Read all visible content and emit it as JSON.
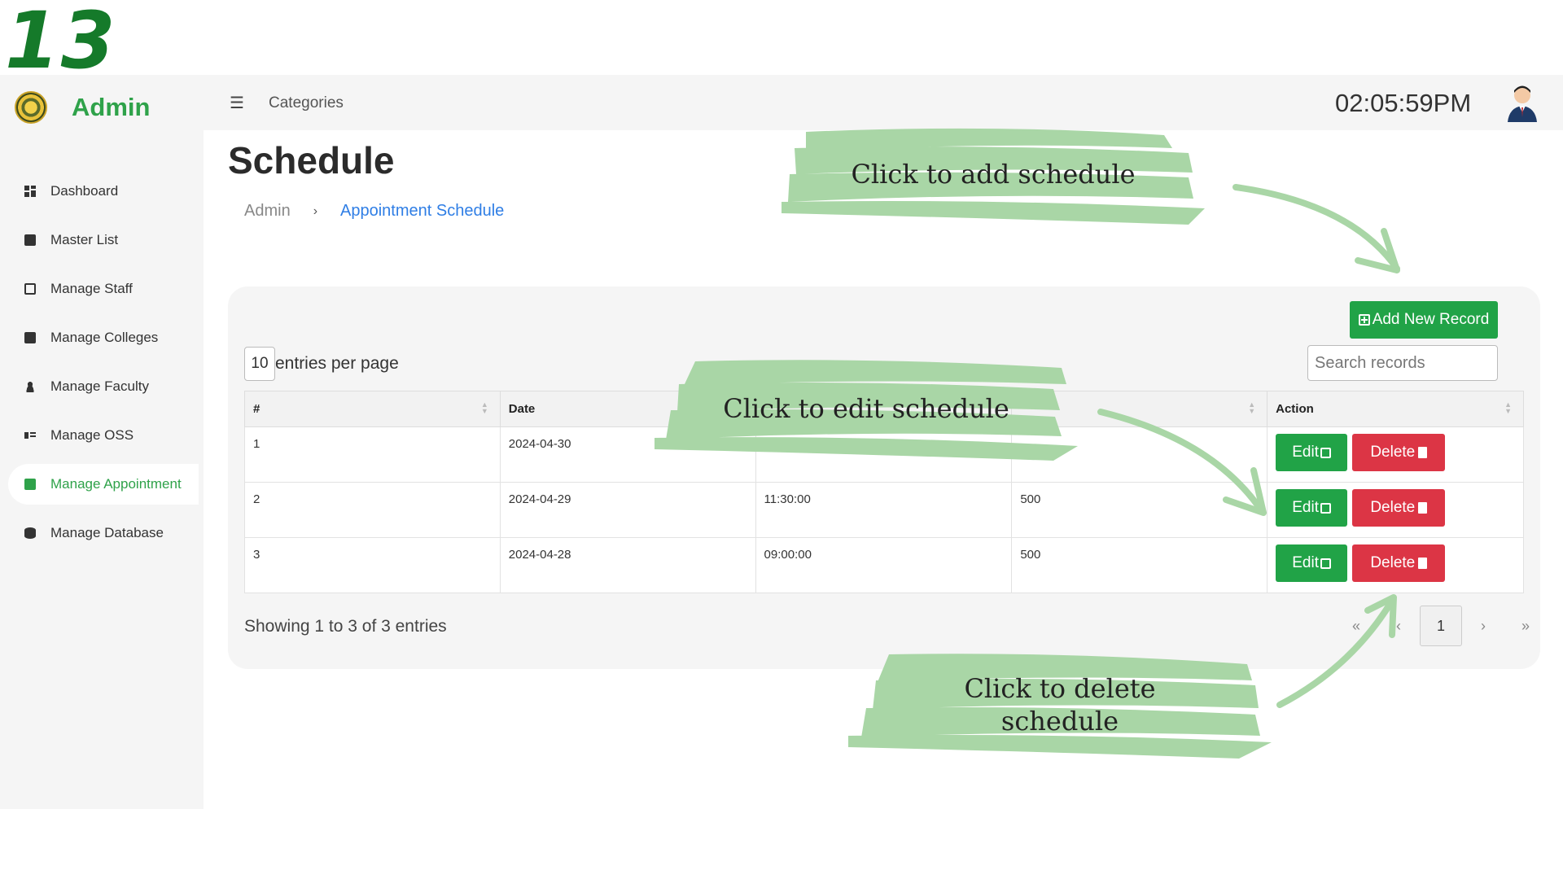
{
  "step_number": "13",
  "brand": {
    "name": "Admin"
  },
  "topbar": {
    "menu_icon": "hamburger-icon",
    "categories_label": "Categories",
    "clock": "02:05:59PM"
  },
  "sidebar": {
    "items": [
      {
        "label": "Dashboard",
        "icon": "dashboard-icon"
      },
      {
        "label": "Master List",
        "icon": "book-icon"
      },
      {
        "label": "Manage Staff",
        "icon": "id-card-icon"
      },
      {
        "label": "Manage Colleges",
        "icon": "book-icon"
      },
      {
        "label": "Manage Faculty",
        "icon": "users-icon"
      },
      {
        "label": "Manage OSS",
        "icon": "user-list-icon"
      },
      {
        "label": "Manage Appointment",
        "icon": "calendar-icon",
        "active": true
      },
      {
        "label": "Manage Database",
        "icon": "database-icon"
      }
    ]
  },
  "page": {
    "title": "Schedule",
    "breadcrumb": {
      "root": "Admin",
      "separator": "›",
      "current": "Appointment Schedule"
    }
  },
  "toolbar": {
    "add_label": "Add New Record",
    "entries_value": "10",
    "entries_label": "entries per page",
    "search_placeholder": "Search records"
  },
  "table": {
    "columns": [
      "#",
      "Date",
      "",
      "",
      "Action"
    ],
    "rows": [
      {
        "num": "1",
        "date": "2024-04-30",
        "time": "",
        "slots": ""
      },
      {
        "num": "2",
        "date": "2024-04-29",
        "time": "11:30:00",
        "slots": "500"
      },
      {
        "num": "3",
        "date": "2024-04-28",
        "time": "09:00:00",
        "slots": "500"
      }
    ],
    "edit_label": "Edit",
    "delete_label": "Delete"
  },
  "footer": {
    "showing": "Showing 1 to 3 of 3 entries",
    "pager": {
      "first": "«",
      "prev": "‹",
      "current": "1",
      "next": "›",
      "last": "»"
    }
  },
  "annotations": {
    "add": "Click to add schedule",
    "edit": "Click to edit schedule",
    "delete": "Click to delete schedule"
  },
  "colors": {
    "brand_green": "#2fa24a",
    "button_green": "#21a347",
    "button_red": "#dc3545",
    "link_blue": "#2f7ee5",
    "note_green": "#a9d6a6"
  }
}
